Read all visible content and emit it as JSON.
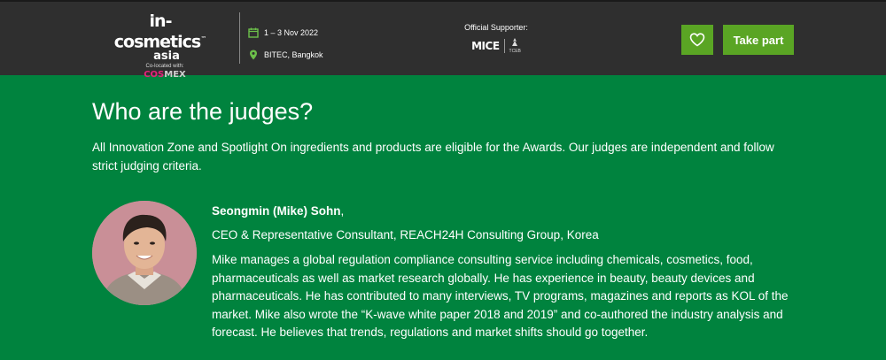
{
  "header": {
    "logo": {
      "brand": "in-cosmetics",
      "tm": "™",
      "region": "asia",
      "colocated": "Co-located with:",
      "partner_a": "COS",
      "partner_b": "MEX"
    },
    "event": {
      "dates": "1 – 3 Nov 2022",
      "venue": "BITEC, Bangkok"
    },
    "supporter": {
      "label": "Official Supporter:",
      "logo_text": "MICE",
      "logo_sub": "TCEB"
    },
    "fav_icon": "heart-icon",
    "cta_label": "Take part"
  },
  "section": {
    "title": "Who are the judges?",
    "intro": "All Innovation Zone and Spotlight On ingredients and products are eligible for the Awards. Our judges are independent and follow strict judging criteria."
  },
  "judges": [
    {
      "name": "Seongmin (Mike) Sohn",
      "name_suffix": ",",
      "role": "CEO & Representative Consultant, REACH24H Consulting Group, Korea",
      "bio": "Mike manages a global regulation compliance consulting service including chemicals, cosmetics, food, pharmaceuticals as well as market research globally. He has experience in beauty, beauty devices and pharmaceuticals. He has contributed to many interviews, TV programs, magazines and reports as KOL of the market. Mike also wrote the “K-wave white paper 2018 and 2019” and co-authored the industry analysis and forecast. He believes that trends, regulations and market shifts should go together."
    }
  ],
  "colors": {
    "header_bg": "#2f2f2f",
    "page_bg": "#00833e",
    "button_bg": "#5aa524",
    "icon_green": "#6cc04a",
    "cosmex_pink": "#e8207a"
  }
}
